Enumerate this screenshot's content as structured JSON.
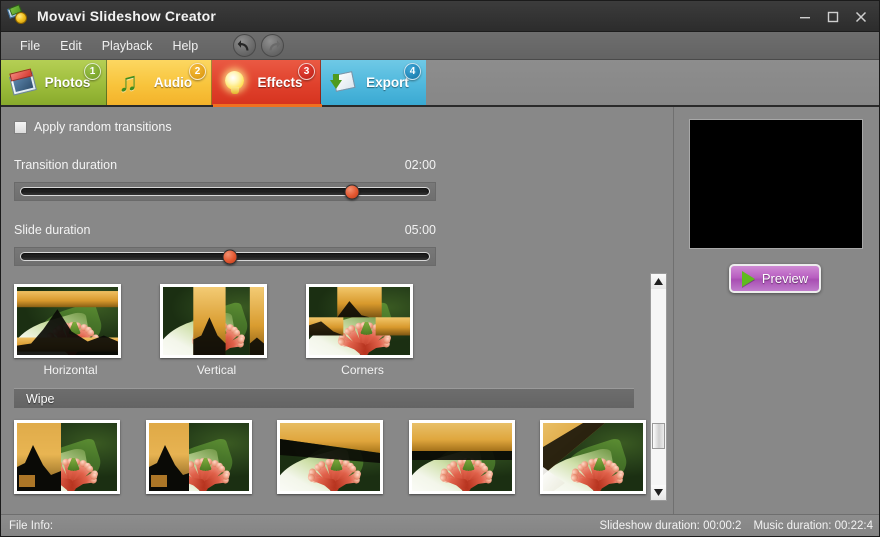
{
  "window": {
    "title": "Movavi Slideshow Creator",
    "app_icon": "movavi-app-icon",
    "controls": {
      "minimize": "minimize-icon",
      "maximize": "maximize-icon",
      "close": "close-icon"
    }
  },
  "menu": {
    "items": [
      {
        "label": "File"
      },
      {
        "label": "Edit"
      },
      {
        "label": "Playback"
      },
      {
        "label": "Help"
      }
    ],
    "history": {
      "undo_icon": "undo-arrow-icon",
      "redo_icon": "redo-arrow-icon"
    }
  },
  "tabs": {
    "active": "Effects",
    "active_indicator_color": "#f07020",
    "items": [
      {
        "label": "Photos",
        "badge": "1",
        "icon": "photos-icon",
        "color": "#9dbd3c"
      },
      {
        "label": "Audio",
        "badge": "2",
        "icon": "audio-note-icon",
        "color": "#f8c43c"
      },
      {
        "label": "Effects",
        "badge": "3",
        "icon": "lightbulb-icon",
        "color": "#e0412c"
      },
      {
        "label": "Export",
        "badge": "4",
        "icon": "export-icon",
        "color": "#4fb8dd"
      }
    ]
  },
  "effects_panel": {
    "random_transitions": {
      "label": "Apply random transitions",
      "checked": false
    },
    "transition_duration": {
      "label": "Transition duration",
      "value": "02:00",
      "position_pct": 79
    },
    "slide_duration": {
      "label": "Slide duration",
      "value": "05:00",
      "position_pct": 50
    },
    "top_transitions": [
      {
        "label": "Horizontal",
        "pattern": "horizontal"
      },
      {
        "label": "Vertical",
        "pattern": "vertical"
      },
      {
        "label": "Corners",
        "pattern": "corners"
      }
    ],
    "groups": [
      {
        "title": "Wipe",
        "items": [
          {
            "pattern": "wipe-left-jag"
          },
          {
            "pattern": "wipe-left-straight"
          },
          {
            "pattern": "wipe-up-diag"
          },
          {
            "pattern": "wipe-up-straight"
          },
          {
            "pattern": "wipe-corner-diag"
          }
        ]
      }
    ],
    "scrollbar": {
      "up_arrow": "scroll-up-icon",
      "down_arrow": "scroll-down-icon"
    }
  },
  "preview": {
    "screen_color": "#000000",
    "button_label": "Preview",
    "play_icon": "play-triangle-icon"
  },
  "status_bar": {
    "file_info": "File Info:",
    "slideshow_duration": "Slideshow duration: 00:00:2",
    "music_duration": "Music duration: 00:22:4"
  }
}
